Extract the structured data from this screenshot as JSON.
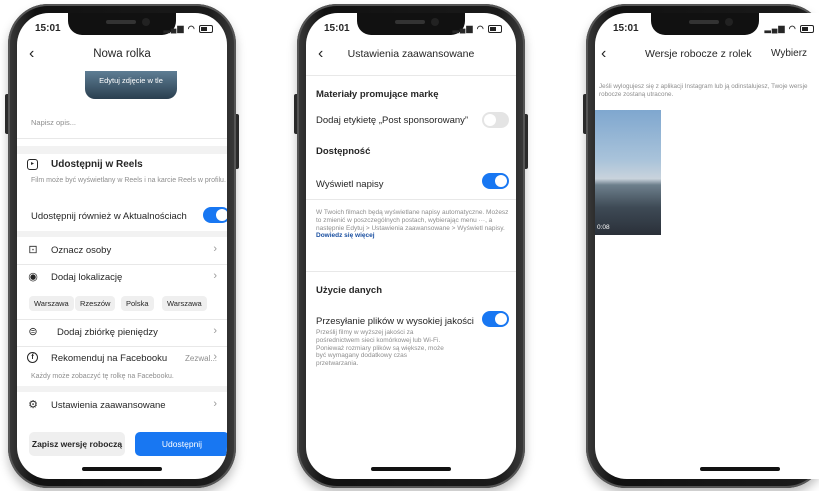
{
  "status": {
    "time": "15:01"
  },
  "phone1": {
    "title": "Nowa rolka",
    "edit_cover": "Edytuj zdjęcie w tle",
    "caption_placeholder": "Napisz opis...",
    "reels_heading": "Udostępnij w Reels",
    "reels_desc": "Film może być wyświetlany w Reels i na karcie Reels w profilu.",
    "also_share": "Udostępnij również w Aktualnościach",
    "tag_people": "Oznacz osoby",
    "add_location": "Dodaj lokalizację",
    "location_chips": [
      "Warszawa",
      "Rzeszów",
      "Polska",
      "Warszawa"
    ],
    "fundraiser": "Dodaj zbiórkę pieniędzy",
    "recommend_fb": "Rekomenduj na Facebooku",
    "recommend_value": "Zezwal...",
    "fb_note": "Każdy może zobaczyć tę rolkę na Facebooku.",
    "advanced": "Ustawienia zaawansowane",
    "save_draft": "Zapisz wersję roboczą",
    "share": "Udostępnij"
  },
  "phone2": {
    "title": "Ustawienia zaawansowane",
    "branded_heading": "Materiały promujące markę",
    "add_label": "Dodaj etykietę „Post sponsorowany”",
    "accessibility_heading": "Dostępność",
    "captions": "Wyświetl napisy",
    "captions_desc": "W Twoich filmach będą wyświetlane napisy automatyczne. Możesz to zmienić w poszczególnych postach, wybierając menu ···, a następnie Edytuj > Ustawienia zaawansowane > Wyświetl napisy.",
    "learn_more": "Dowiedz się więcej",
    "data_heading": "Użycie danych",
    "hq_upload": "Przesyłanie plików w wysokiej jakości",
    "hq_desc": "Prześlij filmy w wyższej jakości za pośrednictwem sieci komórkowej lub Wi-Fi. Ponieważ rozmiary plików są większe, może być wymagany dodatkowy czas przetwarzania."
  },
  "phone3": {
    "title": "Wersje robocze z rolek",
    "select": "Wybierz",
    "notice": "Jeśli wylogujesz się z aplikacji Instagram lub ją odinstalujesz, Twoje wersje robocze zostaną utracone.",
    "draft_duration": "0:08"
  },
  "colors": {
    "accent": "#1877f2",
    "toggle_off": "#e4e4e4"
  }
}
